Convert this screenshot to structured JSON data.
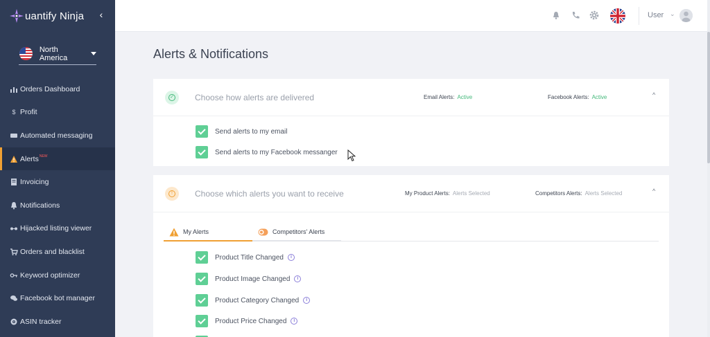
{
  "app": {
    "logo_text": "uantify Ninja",
    "collapse_glyph": "‹"
  },
  "region": {
    "label": "North America",
    "flag_icon": "us-flag-icon"
  },
  "sidebar": {
    "items": [
      {
        "label": "Orders Dashboard",
        "icon": "bar-chart-icon",
        "active": false
      },
      {
        "label": "Profit",
        "icon": "dollar-icon",
        "active": false
      },
      {
        "label": "Automated messaging",
        "icon": "message-icon",
        "active": false
      },
      {
        "label": "Alerts",
        "icon": "warning-icon",
        "active": true,
        "badge": "NEW"
      },
      {
        "label": "Invoicing",
        "icon": "document-icon",
        "active": false
      },
      {
        "label": "Notifications",
        "icon": "bell-icon",
        "active": false
      },
      {
        "label": "Hijacked listing viewer",
        "icon": "glasses-icon",
        "active": false
      },
      {
        "label": "Orders and blacklist",
        "icon": "cart-icon",
        "active": false
      },
      {
        "label": "Keyword optimizer",
        "icon": "key-icon",
        "active": false
      },
      {
        "label": "Facebook bot manager",
        "icon": "chat-icon",
        "active": false
      },
      {
        "label": "ASIN tracker",
        "icon": "target-icon",
        "active": false
      }
    ]
  },
  "topbar": {
    "user_label": "User",
    "caret": "⌄",
    "icons": [
      "bell-icon",
      "phone-icon",
      "gear-icon",
      "uk-flag-icon",
      "avatar"
    ]
  },
  "page": {
    "title": "Alerts & Notifications"
  },
  "delivery": {
    "title": "Choose how alerts are delivered",
    "email_label": "Email Alerts:",
    "email_value": "Active",
    "facebook_label": "Facebook Alerts:",
    "facebook_value": "Active",
    "toggle_glyph": "^",
    "options": [
      {
        "label": "Send alerts to my email",
        "checked": true
      },
      {
        "label": "Send alerts to my Facebook messanger",
        "checked": true
      }
    ]
  },
  "receive": {
    "title": "Choose which alerts you want to receive",
    "product_label": "My Product Alerts:",
    "product_value": "Alerts Selected",
    "competitors_label": "Competitors Alerts:",
    "competitors_value": "Alerts Selected",
    "toggle_glyph": "^",
    "tabs": [
      {
        "label": "My Alerts",
        "icon": "warning-icon",
        "active": true
      },
      {
        "label": "Competitors' Alerts",
        "icon": "toggle-icon",
        "active": false
      }
    ],
    "options": [
      {
        "label": "Product Title Changed",
        "checked": true
      },
      {
        "label": "Product Image Changed",
        "checked": true
      },
      {
        "label": "Product Category Changed",
        "checked": true
      },
      {
        "label": "Product Price Changed",
        "checked": true
      }
    ]
  },
  "colors": {
    "sidebar_bg": "#2f3c56",
    "accent_orange": "#f0a033",
    "active_green": "#43b87a",
    "checkbox_green": "#5fcf95",
    "info_purple": "#8b7fd9"
  }
}
